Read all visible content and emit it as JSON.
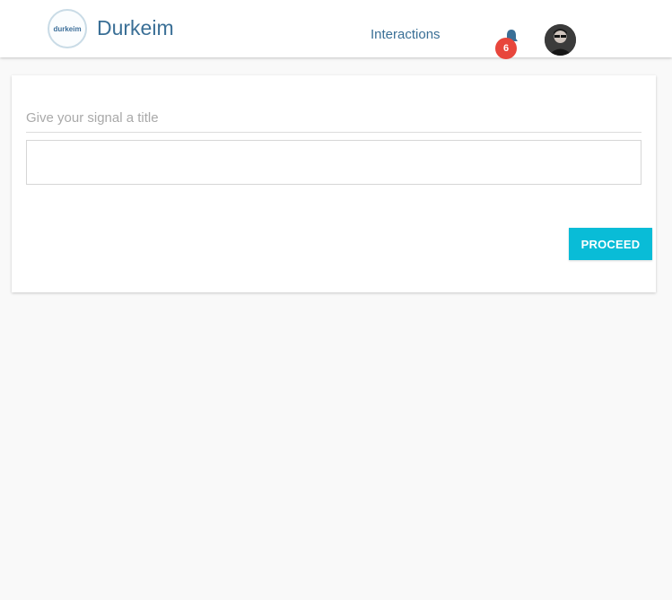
{
  "header": {
    "logo_text": "durkeim",
    "brand": "Durkeim",
    "nav_link": "Interactions",
    "notification_count": "6",
    "bell_icon": "bell-icon",
    "avatar_icon": "user-avatar"
  },
  "form": {
    "title_label": "Give your signal a title",
    "title_value": "",
    "proceed_label": "PROCEED"
  },
  "colors": {
    "brand": "#3a6f96",
    "badge": "#e8463c",
    "button": "#09bcd7",
    "background": "#f9f9f9"
  }
}
